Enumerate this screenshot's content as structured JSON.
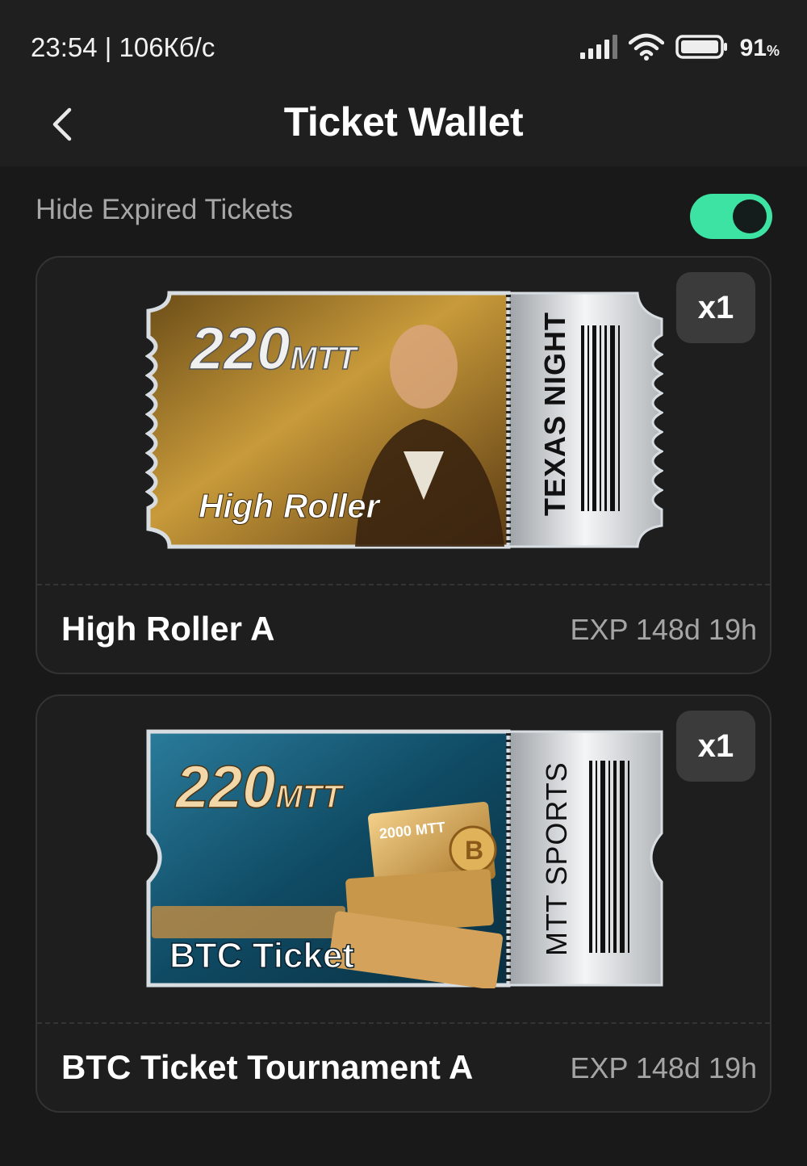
{
  "status_bar": {
    "time": "23:54 | 106Кб/с",
    "battery_percent": "91",
    "battery_unit": "%",
    "icons": [
      "signal-icon",
      "wifi-icon",
      "battery-icon"
    ]
  },
  "header": {
    "title": "Ticket Wallet",
    "back_icon": "chevron-left-icon"
  },
  "filter": {
    "label": "Hide Expired Tickets",
    "enabled": true,
    "accent": "#3de3a3"
  },
  "tickets": [
    {
      "name": "High Roller A",
      "expiry": "EXP 148d 19h",
      "quantity": "x1",
      "art": {
        "amount": "220",
        "unit": "MTT",
        "caption": "High Roller",
        "stub_text": "TEXAS NIGHT",
        "theme_color": "#b88a2c"
      }
    },
    {
      "name": "BTC Ticket Tournament A",
      "expiry": "EXP 148d 19h",
      "quantity": "x1",
      "art": {
        "amount": "220",
        "unit": "MTT",
        "caption": "BTC Ticket",
        "stub_text": "MTT SPORTS",
        "inner_ticket_text": "2000 MTT",
        "theme_color": "#1a5d7a"
      }
    }
  ]
}
